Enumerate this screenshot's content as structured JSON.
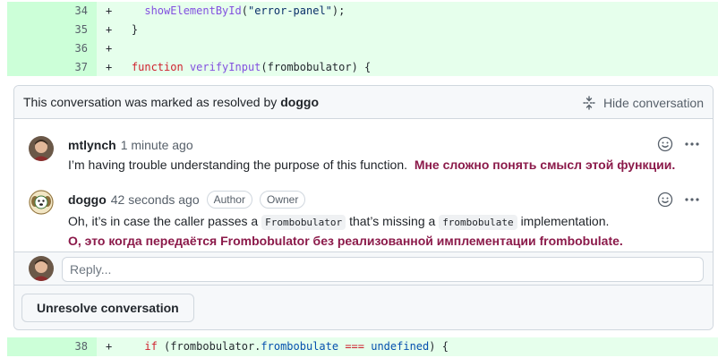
{
  "diff_top": [
    {
      "lineno": "34",
      "prefix": "+",
      "tokens": [
        {
          "t": "    ",
          "c": "tok-plain"
        },
        {
          "t": "showElementById",
          "c": "tok-fn"
        },
        {
          "t": "(",
          "c": "tok-plain"
        },
        {
          "t": "\"error-panel\"",
          "c": "tok-str"
        },
        {
          "t": ");",
          "c": "tok-plain"
        }
      ]
    },
    {
      "lineno": "35",
      "prefix": "+",
      "tokens": [
        {
          "t": "  }",
          "c": "tok-plain"
        }
      ]
    },
    {
      "lineno": "36",
      "prefix": "+",
      "tokens": []
    },
    {
      "lineno": "37",
      "prefix": "+",
      "tokens": [
        {
          "t": "  ",
          "c": "tok-plain"
        },
        {
          "t": "function",
          "c": "tok-kw"
        },
        {
          "t": " ",
          "c": "tok-plain"
        },
        {
          "t": "verifyInput",
          "c": "tok-fn"
        },
        {
          "t": "(frombobulator) {",
          "c": "tok-plain"
        }
      ]
    }
  ],
  "diff_bottom": [
    {
      "lineno": "38",
      "prefix": "+",
      "tokens": [
        {
          "t": "    ",
          "c": "tok-plain"
        },
        {
          "t": "if",
          "c": "tok-kw"
        },
        {
          "t": " (frombobulator.",
          "c": "tok-plain"
        },
        {
          "t": "frombobulate",
          "c": "tok-prop"
        },
        {
          "t": " === ",
          "c": "tok-kw"
        },
        {
          "t": "undefined",
          "c": "tok-prop"
        },
        {
          "t": ") {",
          "c": "tok-plain"
        }
      ]
    }
  ],
  "thread": {
    "resolved_text": "This conversation was marked as resolved by",
    "resolved_by": "doggo",
    "hide_label": "Hide conversation",
    "comments": [
      {
        "author": "mtlynch",
        "time": "1 minute ago",
        "body_en": "I’m having trouble understanding the purpose of this function.",
        "body_ru": "Мне сложно понять смысл этой функции."
      },
      {
        "author": "doggo",
        "time": "42 seconds ago",
        "badges": [
          "Author",
          "Owner"
        ],
        "body_part1": "Oh, it’s in case the caller passes a",
        "code1": "Frombobulator",
        "body_part2": "that’s missing a",
        "code2": "frombobulate",
        "body_part3": "implementation.",
        "body_ru": "О, это когда передаётся Frombobulator без реализованной имплементации frombobulate."
      }
    ],
    "reply_placeholder": "Reply...",
    "unresolve_label": "Unresolve conversation"
  },
  "colors": {
    "added_bg": "#e6ffec",
    "added_gutter": "#ccffd8",
    "russian_text": "#8b1a4a"
  }
}
